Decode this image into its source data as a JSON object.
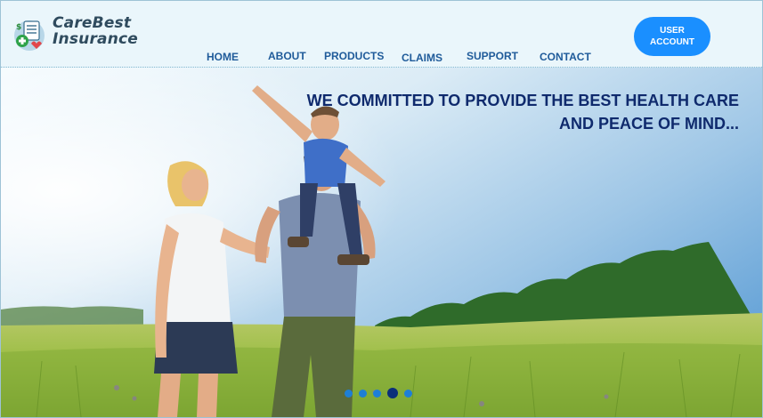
{
  "brand": {
    "line1": "CareBest",
    "line2": "Insurance",
    "logo_icon": "document-medical-cross-icon"
  },
  "nav": {
    "home": "HOME",
    "about": "ABOUT",
    "products": "PRODUCTS",
    "claims": "CLAIMS",
    "support": "SUPPORT",
    "contact": "CONTACT"
  },
  "user_account": {
    "line1": "USER",
    "line2": "ACCOUNT"
  },
  "hero": {
    "headline_line1": "WE COMMITTED TO PROVIDE THE BEST HEALTH CARE",
    "headline_line2": "AND PEACE OF MIND...",
    "image_description": "family-in-meadow-photo",
    "slides_total": 5,
    "slide_active": 4
  },
  "colors": {
    "header_bg": "#eaf6fb",
    "nav_text": "#1f5b9a",
    "button_bg": "#1a8fff",
    "headline": "#0f2a6d",
    "dot": "#1e7fd6",
    "dot_active": "#0b2f7a"
  }
}
